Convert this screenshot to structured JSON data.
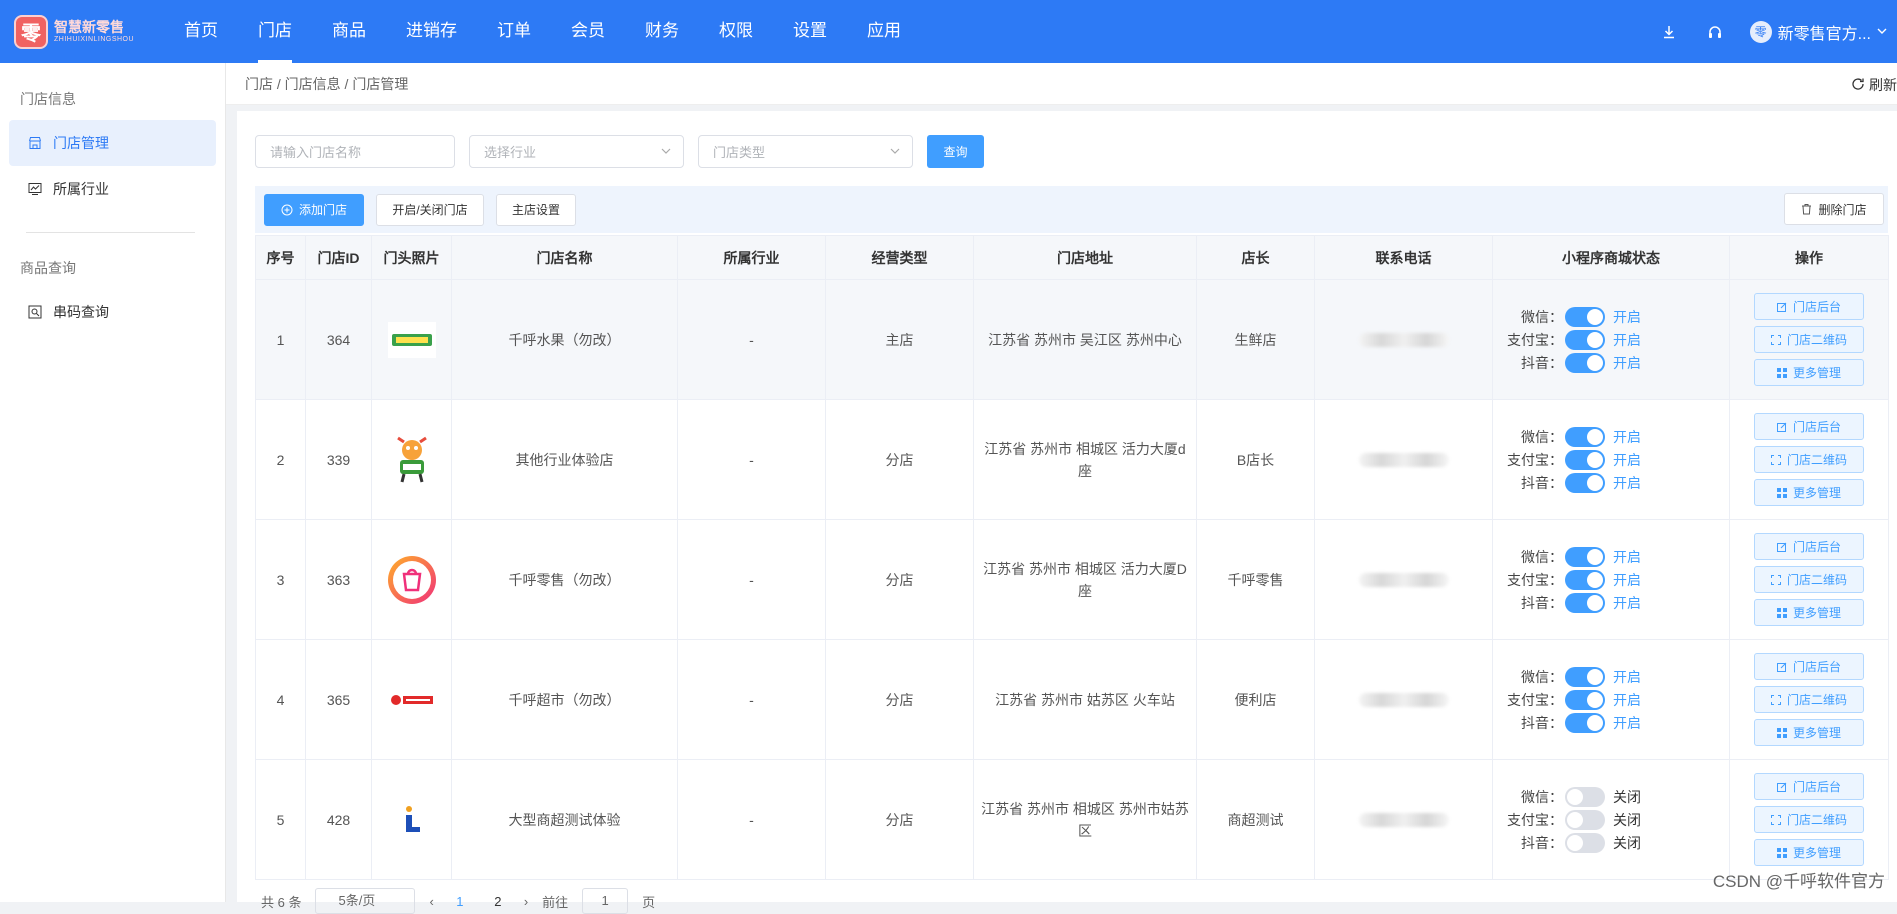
{
  "app": {
    "logo_mark": "零",
    "logo_text": "智慧新零售",
    "logo_sub": "ZHIHUIXINLINGSHOU"
  },
  "nav": {
    "items": [
      "首页",
      "门店",
      "商品",
      "进销存",
      "订单",
      "会员",
      "财务",
      "权限",
      "设置",
      "应用"
    ],
    "active": "门店"
  },
  "user": {
    "name": "新零售官方...",
    "avatar_glyph": "零"
  },
  "icons": {
    "download": "download-icon",
    "support": "headset-icon",
    "dropdown": "chevron-down-icon"
  },
  "sidebar": {
    "groups": [
      {
        "title": "门店信息",
        "items": [
          {
            "label": "门店管理",
            "icon": "shop-icon",
            "active": true
          },
          {
            "label": "所属行业",
            "icon": "chart-icon",
            "active": false
          }
        ]
      },
      {
        "title": "商品查询",
        "items": [
          {
            "label": "串码查询",
            "icon": "barcode-search-icon",
            "active": false
          }
        ]
      }
    ]
  },
  "breadcrumb": "门店 / 门店信息 / 门店管理",
  "refresh_label": "刷新",
  "filters": {
    "name_placeholder": "请输入门店名称",
    "industry_placeholder": "选择行业",
    "type_placeholder": "门店类型",
    "query_label": "查询"
  },
  "toolbar": {
    "add_label": "添加门店",
    "toggle_label": "开启/关闭门店",
    "main_label": "主店设置",
    "delete_label": "删除门店"
  },
  "table": {
    "headers": [
      "序号",
      "门店ID",
      "门头照片",
      "门店名称",
      "所属行业",
      "经营类型",
      "门店地址",
      "店长",
      "联系电话",
      "小程序商城状态",
      "操作"
    ],
    "status_labels": [
      "微信：",
      "支付宝：",
      "抖音："
    ],
    "ops_labels": [
      "门店后台",
      "门店二维码",
      "更多管理"
    ],
    "rows": [
      {
        "no": "1",
        "id": "364",
        "name": "千呼水果（勿改）",
        "industry": "-",
        "type": "主店",
        "address": "江苏省 苏州市 吴江区 苏州中心",
        "manager": "生鲜店",
        "img": "fruit",
        "status": [
          "开启",
          "开启",
          "开启"
        ],
        "on": [
          true,
          true,
          true
        ]
      },
      {
        "no": "2",
        "id": "339",
        "name": "其他行业体验店",
        "industry": "-",
        "type": "分店",
        "address": "江苏省 苏州市 相城区 活力大厦d座",
        "manager": "B店长",
        "img": "mascot",
        "status": [
          "开启",
          "开启",
          "开启"
        ],
        "on": [
          true,
          true,
          true
        ]
      },
      {
        "no": "3",
        "id": "363",
        "name": "千呼零售（勿改）",
        "industry": "-",
        "type": "分店",
        "address": "江苏省 苏州市 相城区 活力大厦D座",
        "manager": "千呼零售",
        "img": "buy",
        "status": [
          "开启",
          "开启",
          "开启"
        ],
        "on": [
          true,
          true,
          true
        ]
      },
      {
        "no": "4",
        "id": "365",
        "name": "千呼超市（勿改）",
        "industry": "-",
        "type": "分店",
        "address": "江苏省 苏州市 姑苏区 火车站",
        "manager": "便利店",
        "img": "market",
        "status": [
          "开启",
          "开启",
          "开启"
        ],
        "on": [
          true,
          true,
          true
        ]
      },
      {
        "no": "5",
        "id": "428",
        "name": "大型商超测试体验",
        "industry": "-",
        "type": "分店",
        "address": "江苏省 苏州市 相城区 苏州市姑苏区",
        "manager": "商超测试",
        "img": "L",
        "status": [
          "关闭",
          "关闭",
          "关闭"
        ],
        "on": [
          false,
          false,
          false
        ]
      }
    ]
  },
  "pager": {
    "total": "共 6 条",
    "size": "5条/页",
    "pages": [
      "1",
      "2"
    ],
    "current": "1",
    "jump_pre": "前往",
    "jump_val": "1",
    "jump_post": "页"
  },
  "watermark": "CSDN @千呼软件官方",
  "colors": {
    "primary": "#2d7af5",
    "button": "#409eff"
  }
}
